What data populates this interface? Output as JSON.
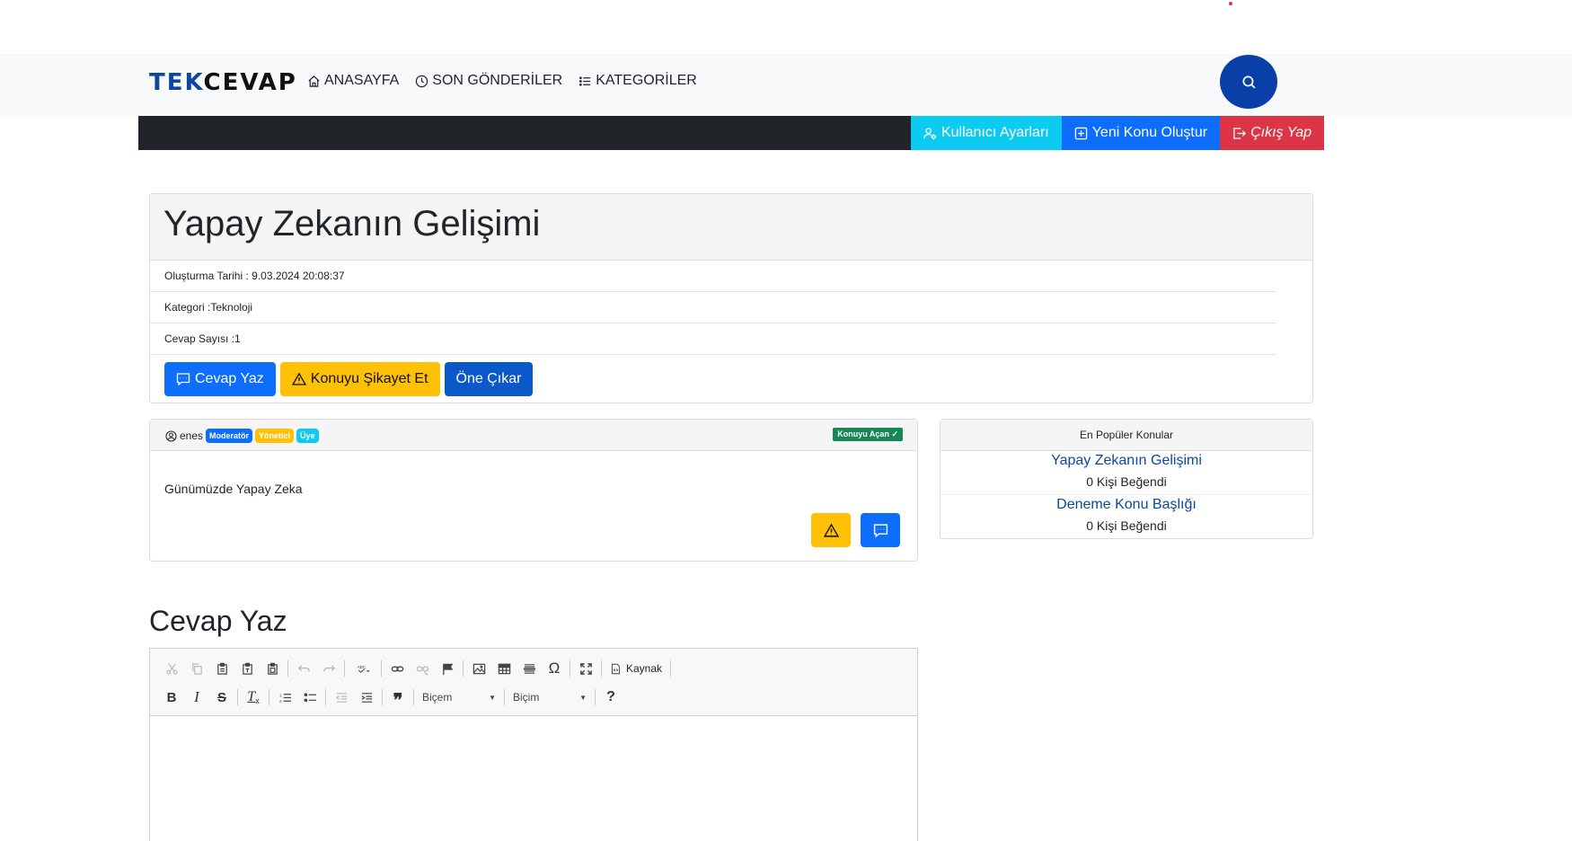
{
  "brand": {
    "part1": "TEK",
    "part2": "CEVAP"
  },
  "nav": {
    "home": "ANASAYFA",
    "recent": "SON GÖNDERİLER",
    "categories": "KATEGORİLER"
  },
  "userbar": {
    "settings": "Kullanıcı Ayarları",
    "new_topic": "Yeni Konu Oluştur",
    "logout": "Çıkış Yap"
  },
  "topic": {
    "title": "Yapay Zekanın Gelişimi",
    "created": "Oluşturma Tarihi : 9.03.2024 20:08:37",
    "category": "Kategori :Teknoloji",
    "reply_count": "Cevap Sayısı :1",
    "btn_reply": "Cevap Yaz",
    "btn_report": "Konuyu Şikayet Et",
    "btn_feature": "Öne Çıkar"
  },
  "post": {
    "username": "enes",
    "badges": [
      "Moderatör",
      "Yönetici",
      "Üye"
    ],
    "owner_badge": "Konuyu Açan",
    "content": "Günümüzde Yapay Zeka"
  },
  "popular": {
    "title": "En Popüler Konular",
    "items": [
      {
        "title": "Yapay Zekanın Gelişimi",
        "likes": "0 Kişi Beğendi"
      },
      {
        "title": "Deneme Konu Başlığı",
        "likes": "0 Kişi Beğendi"
      }
    ]
  },
  "reply": {
    "title": "Cevap Yaz"
  },
  "editor": {
    "source_label": "Kaynak",
    "style_combo": "Biçem",
    "format_combo": "Biçim",
    "help": "?"
  },
  "colors": {
    "brand_blue": "#0d47a1",
    "search_btn": "#0a3fa8",
    "cyan": "#0dcaf0",
    "primary": "#0d6efd",
    "danger": "#dc3545",
    "warning": "#ffc107",
    "success": "#198754",
    "dark": "#212529"
  }
}
